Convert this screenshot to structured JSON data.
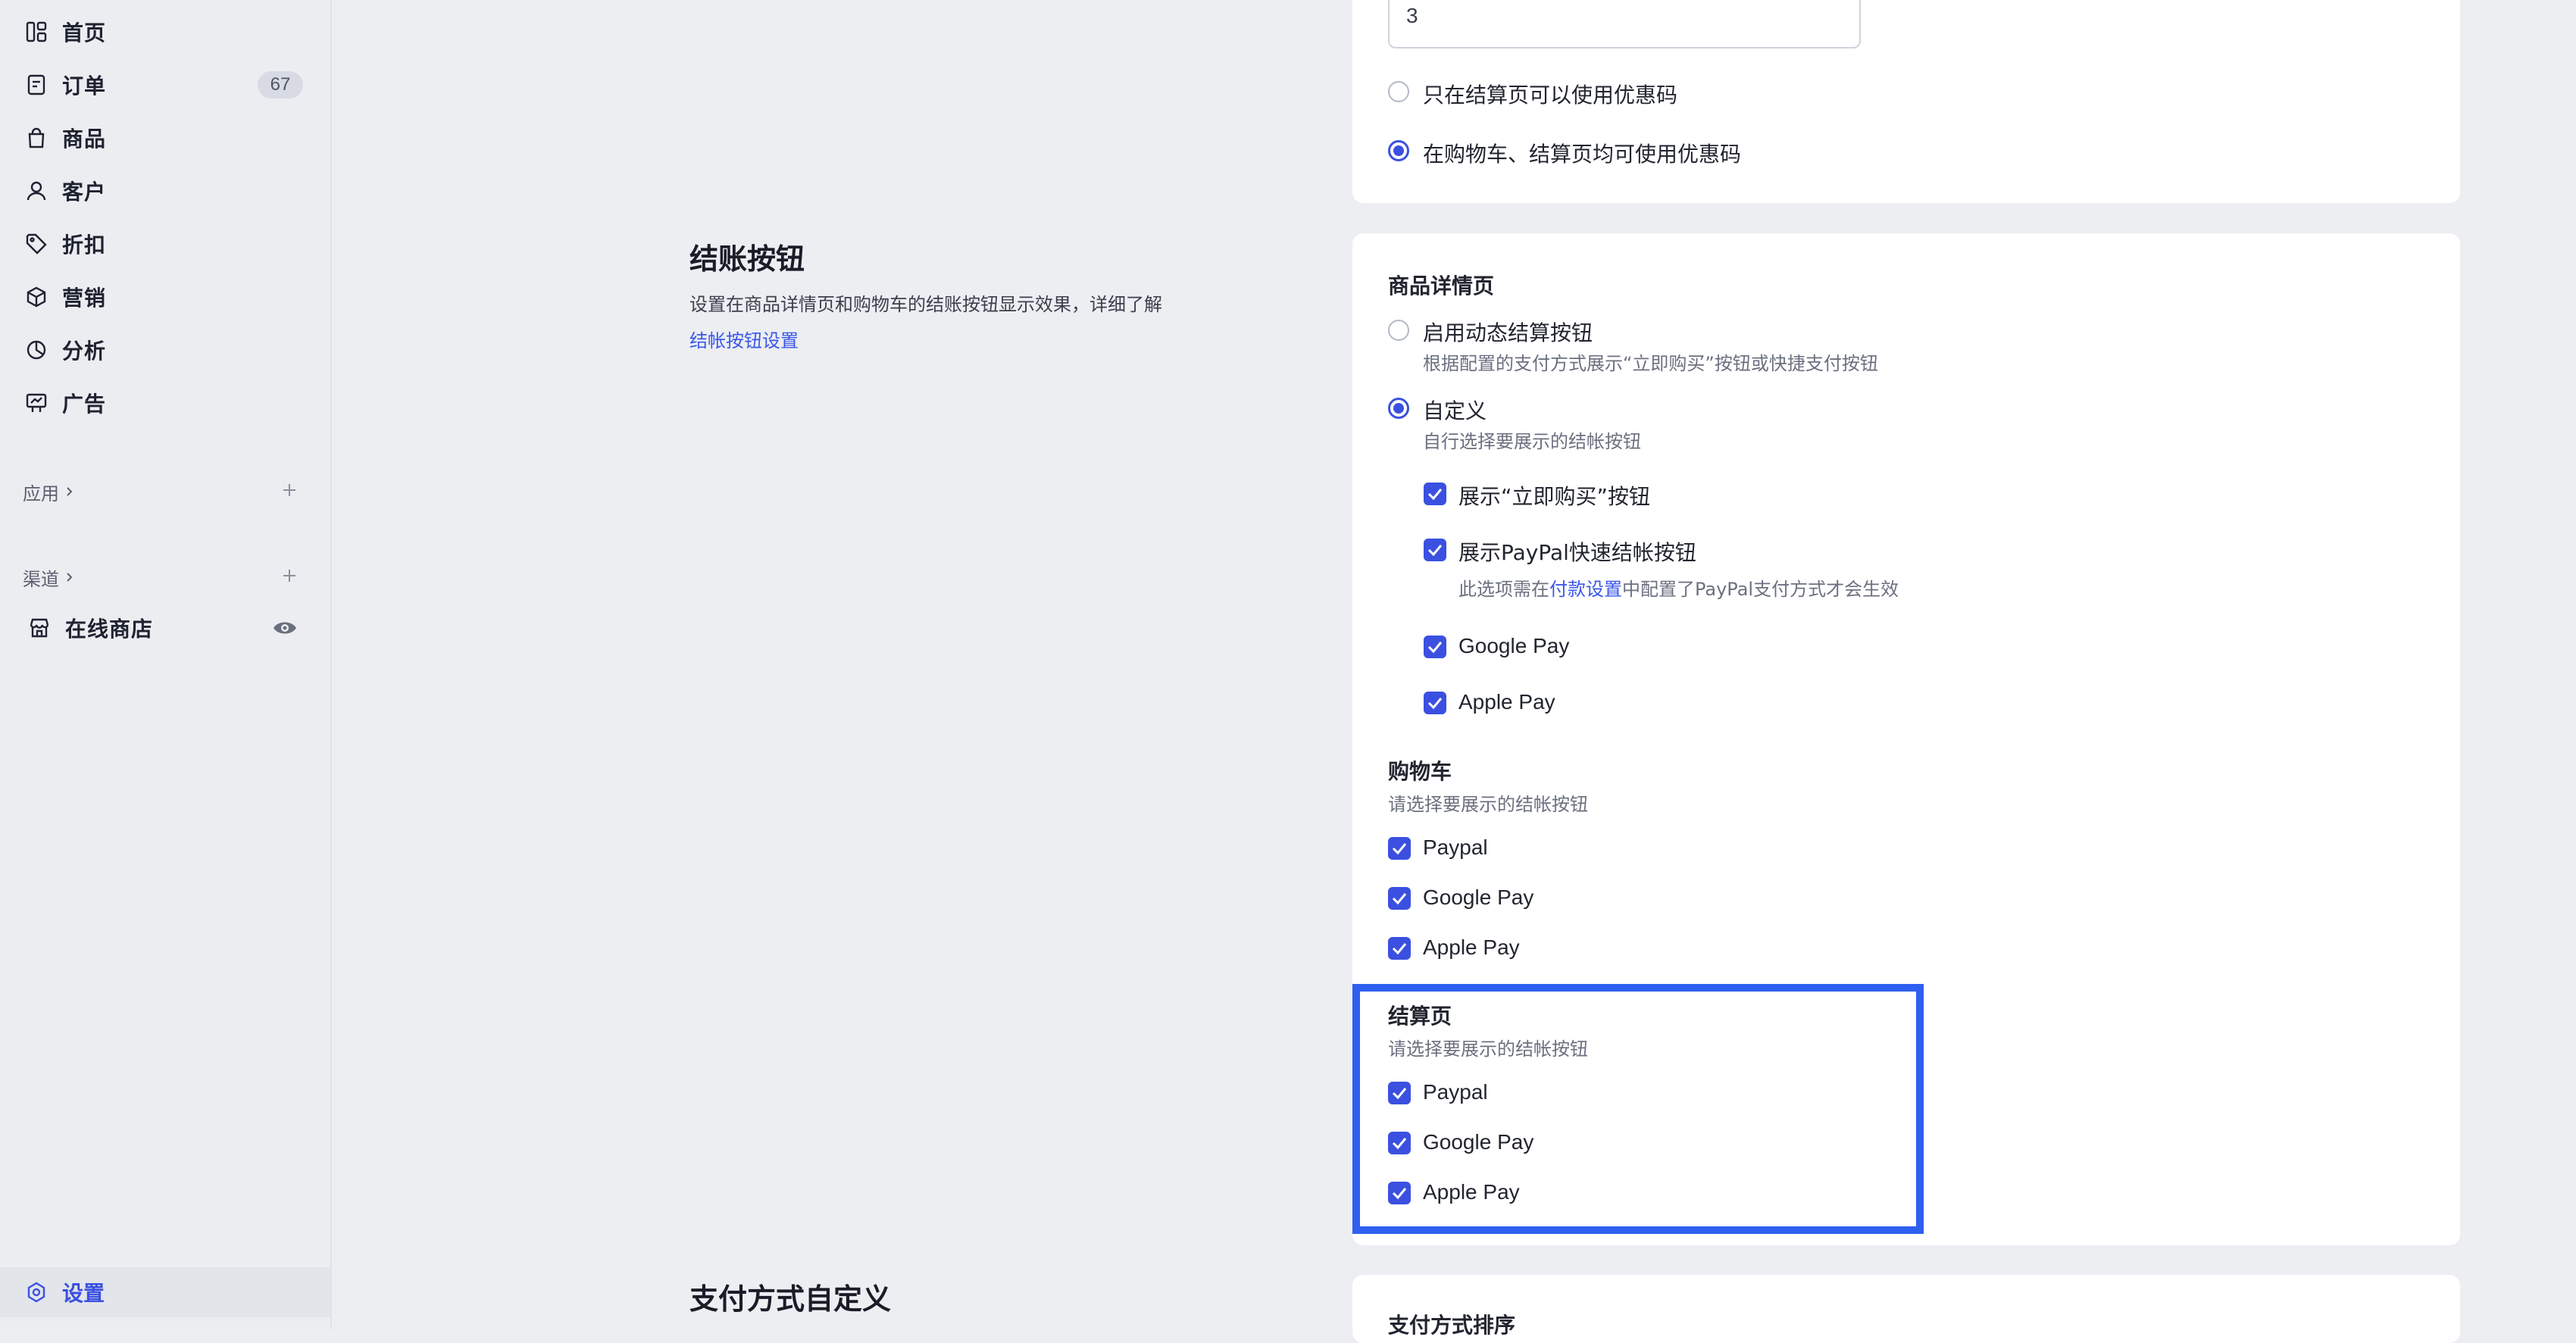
{
  "sidebar": {
    "items": [
      {
        "label": "首页",
        "icon": "home-icon"
      },
      {
        "label": "订单",
        "icon": "order-icon",
        "badge": "67"
      },
      {
        "label": "商品",
        "icon": "bag-icon"
      },
      {
        "label": "客户",
        "icon": "user-icon"
      },
      {
        "label": "折扣",
        "icon": "tag-icon"
      },
      {
        "label": "营销",
        "icon": "box-icon"
      },
      {
        "label": "分析",
        "icon": "pie-icon"
      },
      {
        "label": "广告",
        "icon": "billboard-icon"
      }
    ],
    "apps_label": "应用",
    "channels_label": "渠道",
    "online_store_label": "在线商店",
    "settings_label": "设置"
  },
  "coupon_card": {
    "input_value": "3",
    "option_checkout_only": "只在结算页可以使用优惠码",
    "option_cart_and_checkout": "在购物车、结算页均可使用优惠码",
    "selected": "option_cart_and_checkout"
  },
  "checkout_section": {
    "title": "结账按钮",
    "description": "设置在商品详情页和购物车的结账按钮显示效果，详细了解",
    "link": "结帐按钮设置"
  },
  "product_page": {
    "title": "商品详情页",
    "dynamic_label": "启用动态结算按钮",
    "dynamic_desc": "根据配置的支付方式展示“立即购买”按钮或快捷支付按钮",
    "custom_label": "自定义",
    "custom_desc": "自行选择要展示的结帐按钮",
    "selected": "custom",
    "buy_now_label": "展示“立即购买”按钮",
    "paypal_express_label": "展示PayPal快速结帐按钮",
    "paypal_note_prefix": "此选项需在",
    "paypal_note_link": "付款设置",
    "paypal_note_suffix": "中配置了PayPal支付方式才会生效",
    "google_pay": "Google Pay",
    "apple_pay": "Apple Pay"
  },
  "cart": {
    "title": "购物车",
    "desc": "请选择要展示的结帐按钮",
    "options": [
      "Paypal",
      "Google Pay",
      "Apple Pay"
    ]
  },
  "checkout_page": {
    "title": "结算页",
    "desc": "请选择要展示的结帐按钮",
    "options": [
      "Paypal",
      "Google Pay",
      "Apple Pay"
    ]
  },
  "payment_section": {
    "title": "支付方式自定义",
    "card_title": "支付方式排序"
  },
  "colors": {
    "accent": "#3b50e0",
    "link": "#3a57e8",
    "highlight_border": "#2f5ff0",
    "page_bg": "#eceef2",
    "card_bg": "#ffffff"
  }
}
